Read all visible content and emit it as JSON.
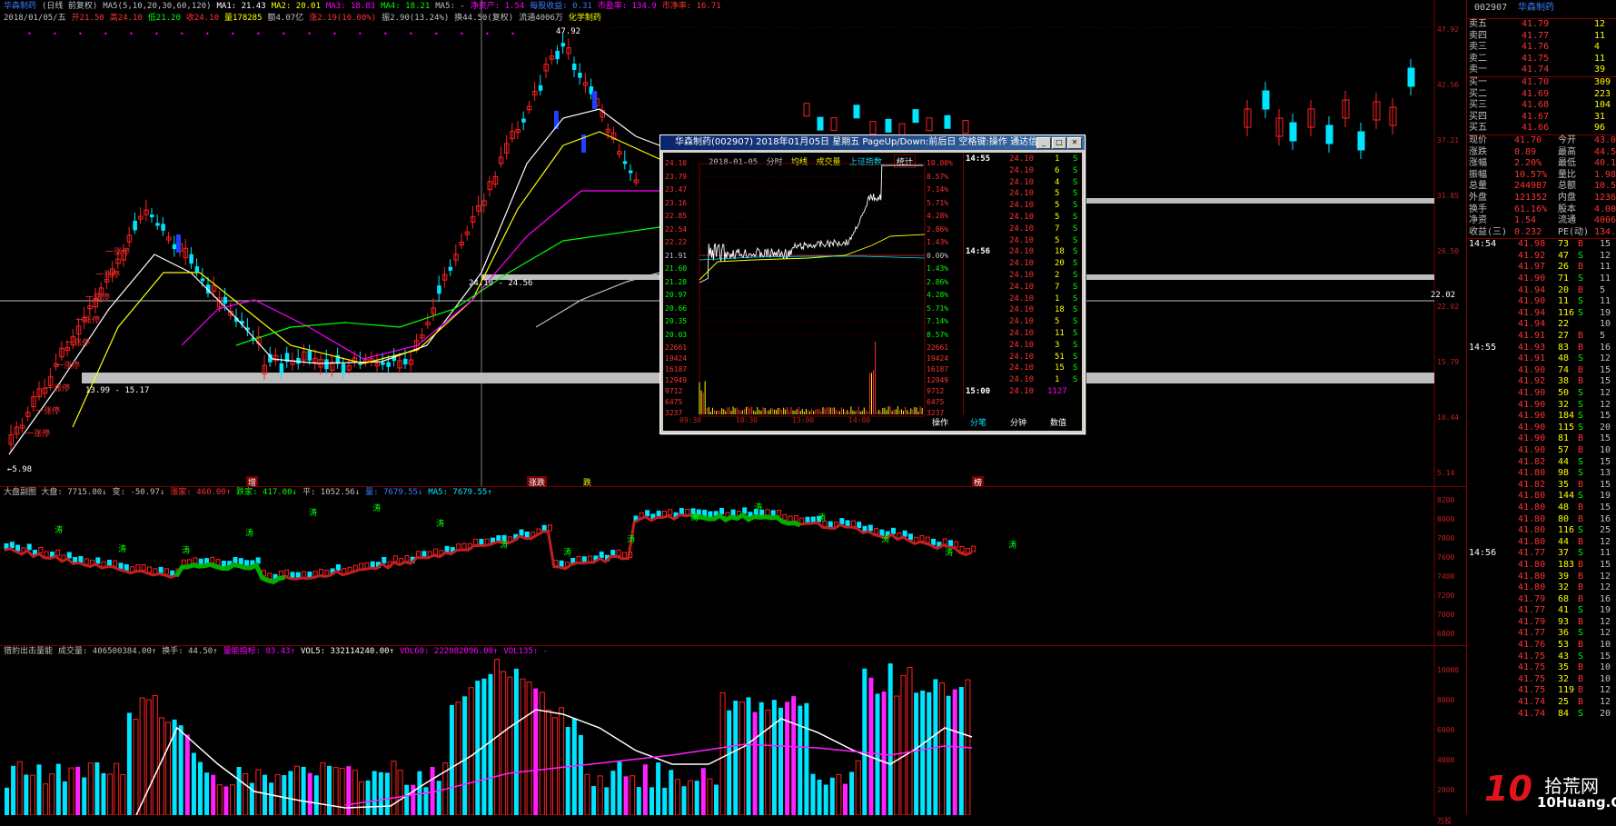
{
  "main_header": {
    "line1": [
      {
        "t": "华森制药",
        "c": "#3c7cff"
      },
      {
        "t": "(日线 前复权)",
        "c": "#c0c0c0"
      },
      {
        "t": "MA5(5,10,20,30,60,120)",
        "c": "#c0c0c0"
      },
      {
        "t": "MA1: 21.43",
        "c": "#ffffff"
      },
      {
        "t": "MA2: 20.01",
        "c": "#ffff00"
      },
      {
        "t": "MA3: 18.83",
        "c": "#ff00ff"
      },
      {
        "t": "MA4: 18.21",
        "c": "#00ff00"
      },
      {
        "t": "MA5: -",
        "c": "#c0c0c0"
      },
      {
        "t": "净资产: 1.54",
        "c": "#ff00ff"
      },
      {
        "t": "每股收益: 0.31",
        "c": "#3c7cff"
      },
      {
        "t": "市盈率: 134.9",
        "c": "#ff00ff"
      },
      {
        "t": "市净率: 16.71",
        "c": "#ff3232"
      }
    ],
    "line2": [
      {
        "t": "2018/01/05/五",
        "c": "#c0c0c0"
      },
      {
        "t": "开21.50",
        "c": "#ff3232"
      },
      {
        "t": "高24.10",
        "c": "#ff3232"
      },
      {
        "t": "低21.20",
        "c": "#00ff00"
      },
      {
        "t": "收24.10",
        "c": "#ff3232"
      },
      {
        "t": "量178285",
        "c": "#ffff00"
      },
      {
        "t": "额4.07亿",
        "c": "#c0c0c0"
      },
      {
        "t": "涨2.19(10.00%)",
        "c": "#ff3232"
      },
      {
        "t": "振2.90(13.24%)",
        "c": "#c0c0c0"
      },
      {
        "t": "换44.50(复权)",
        "c": "#c0c0c0"
      },
      {
        "t": "流通4006万",
        "c": "#c0c0c0"
      },
      {
        "t": "化学制药",
        "c": "#ffff00"
      }
    ]
  },
  "main_chart": {
    "high_label": "47.92",
    "range1": "13.99 - 15.17",
    "range2": "24.10 - 24.56",
    "low_label": "5.98",
    "price_ticks": [
      "47.92",
      "42.56",
      "37.21",
      "31.85",
      "26.50",
      "22.02",
      "15.79",
      "10.44",
      "5.14"
    ],
    "crosshair_value": "22.02",
    "markers": [
      "增",
      "涨跌",
      "跌",
      "榜"
    ],
    "signal": "一涨停"
  },
  "index_panel": {
    "header": [
      {
        "t": "大盘副图 大盘: 7715.80↓",
        "c": "#c0c0c0"
      },
      {
        "t": "变: -50.97↓",
        "c": "#c0c0c0"
      },
      {
        "t": "涨家: 460.00↑",
        "c": "#ff3232"
      },
      {
        "t": "跌家: 417.00↓",
        "c": "#00ff00"
      },
      {
        "t": "平: 1052.56↓",
        "c": "#c0c0c0"
      },
      {
        "t": "量: 7679.55↓",
        "c": "#3c7cff"
      },
      {
        "t": "MA5: 7679.55↑",
        "c": "#00e5ff"
      }
    ],
    "ticks": [
      "8200",
      "8000",
      "7800",
      "7600",
      "7400",
      "7200",
      "7000",
      "6800"
    ],
    "tag": "涛"
  },
  "volume_panel": {
    "header": [
      {
        "t": "猎豹出击量能",
        "c": "#c0c0c0"
      },
      {
        "t": "成交量: 406500384.00↑",
        "c": "#c0c0c0"
      },
      {
        "t": "换手: 44.50↑",
        "c": "#c0c0c0"
      },
      {
        "t": "量能指标: 83.43↑",
        "c": "#ff00ff"
      },
      {
        "t": "VOL5: 332114240.00↑",
        "c": "#ffffff"
      },
      {
        "t": "VOL60: 222082096.00↑",
        "c": "#ff00ff"
      },
      {
        "t": "VOL135: -",
        "c": "#ff00ff"
      }
    ],
    "ticks": [
      "10000",
      "8000",
      "6000",
      "4000",
      "2000",
      "万股"
    ]
  },
  "popup": {
    "title": "华森制药(002907) 2018年01月05日 星期五 PageUp/Down:前后日 空格键:操作 通达信(R)",
    "sub_date": "2018-01-05",
    "sub_items": [
      "分时",
      "均线",
      "成交量",
      "上证指数"
    ],
    "stat_btn": "统计",
    "left_prices": [
      "24.10",
      "23.79",
      "23.47",
      "23.16",
      "22.85",
      "22.54",
      "22.22",
      "21.91",
      "21.60",
      "21.28",
      "20.97",
      "20.66",
      "20.35",
      "20.03"
    ],
    "right_pcts": [
      "10.00%",
      "8.57%",
      "7.14%",
      "5.71%",
      "4.28%",
      "2.86%",
      "1.43%",
      "0.00%",
      "1.43%",
      "2.86%",
      "4.28%",
      "5.71%",
      "7.14%",
      "8.57%"
    ],
    "vol_ticks": [
      "22661",
      "19424",
      "16187",
      "12949",
      "9712",
      "6475",
      "3237"
    ],
    "times": [
      "09:30",
      "10:30",
      "13:00",
      "14:00"
    ],
    "op_btn": "操作",
    "ticks_groups": [
      {
        "time": "14:55",
        "rows": [
          [
            "24.10",
            "1",
            "S"
          ],
          [
            "24.10",
            "6",
            "S"
          ],
          [
            "24.10",
            "4",
            "S"
          ],
          [
            "24.10",
            "5",
            "S"
          ],
          [
            "24.10",
            "5",
            "S"
          ],
          [
            "24.10",
            "5",
            "S"
          ],
          [
            "24.10",
            "7",
            "S"
          ],
          [
            "24.10",
            "5",
            "S"
          ]
        ]
      },
      {
        "time": "14:56",
        "rows": [
          [
            "24.10",
            "18",
            "S"
          ],
          [
            "24.10",
            "20",
            "S"
          ],
          [
            "24.10",
            "2",
            "S"
          ],
          [
            "24.10",
            "7",
            "S"
          ],
          [
            "24.10",
            "1",
            "S"
          ],
          [
            "24.10",
            "18",
            "S"
          ],
          [
            "24.10",
            "5",
            "S"
          ],
          [
            "24.10",
            "11",
            "S"
          ],
          [
            "24.10",
            "3",
            "S"
          ],
          [
            "24.10",
            "51",
            "S"
          ],
          [
            "24.10",
            "15",
            "S"
          ],
          [
            "24.10",
            "1",
            "S"
          ]
        ]
      },
      {
        "time": "15:00",
        "rows": [
          [
            "24.10",
            "1127",
            ""
          ]
        ]
      }
    ],
    "tabs": [
      "分笔",
      "分钟",
      "数值"
    ]
  },
  "quote": {
    "code": "002907",
    "name": "华森制药",
    "sell": [
      [
        "卖五",
        "41.79",
        "12"
      ],
      [
        "卖四",
        "41.77",
        "11"
      ],
      [
        "卖三",
        "41.76",
        "4"
      ],
      [
        "卖二",
        "41.75",
        "11"
      ],
      [
        "卖一",
        "41.74",
        "39"
      ]
    ],
    "buy": [
      [
        "买一",
        "41.70",
        "309"
      ],
      [
        "买二",
        "41.69",
        "223"
      ],
      [
        "买三",
        "41.68",
        "104"
      ],
      [
        "买四",
        "41.67",
        "31"
      ],
      [
        "买五",
        "41.66",
        "96"
      ]
    ],
    "stats": [
      [
        "现价",
        "41.70",
        "今开",
        "43.00"
      ],
      [
        "涨跌",
        "0.89",
        "最高",
        "44.50"
      ],
      [
        "涨幅",
        "2.20%",
        "最低",
        "40.10"
      ],
      [
        "振幅",
        "10.57%",
        "量比",
        "1.98"
      ],
      [
        "总量",
        "244987",
        "总额",
        "10.5亿"
      ],
      [
        "外盘",
        "121352",
        "内盘",
        "123635"
      ],
      [
        "换手",
        "61.16%",
        "股本",
        "4.00亿"
      ],
      [
        "净资",
        "1.54",
        "流通",
        "4006万"
      ],
      [
        "收益(三)",
        "0.232",
        "PE(动)",
        "134.9"
      ]
    ],
    "ticks": [
      [
        "14:54",
        "41.98",
        "73",
        "B",
        "15"
      ],
      [
        "",
        "41.92",
        "47",
        "S",
        "12"
      ],
      [
        "",
        "41.97",
        "26",
        "B",
        "11"
      ],
      [
        "",
        "41.90",
        "71",
        "S",
        "11"
      ],
      [
        "",
        "41.94",
        "20",
        "B",
        "5"
      ],
      [
        "",
        "41.90",
        "11",
        "S",
        "11"
      ],
      [
        "",
        "41.94",
        "116",
        "S",
        "19"
      ],
      [
        "",
        "41.94",
        "22",
        "",
        "10"
      ],
      [
        "",
        "41.91",
        "27",
        "B",
        "5"
      ],
      [
        "14:55",
        "41.93",
        "83",
        "B",
        "16"
      ],
      [
        "",
        "41.91",
        "48",
        "S",
        "12"
      ],
      [
        "",
        "41.90",
        "74",
        "B",
        "15"
      ],
      [
        "",
        "41.92",
        "38",
        "B",
        "15"
      ],
      [
        "",
        "41.90",
        "50",
        "S",
        "12"
      ],
      [
        "",
        "41.90",
        "32",
        "S",
        "12"
      ],
      [
        "",
        "41.90",
        "184",
        "S",
        "15"
      ],
      [
        "",
        "41.90",
        "115",
        "S",
        "20"
      ],
      [
        "",
        "41.90",
        "81",
        "B",
        "15"
      ],
      [
        "",
        "41.90",
        "57",
        "B",
        "10"
      ],
      [
        "",
        "41.82",
        "44",
        "S",
        "15"
      ],
      [
        "",
        "41.80",
        "98",
        "S",
        "13"
      ],
      [
        "",
        "41.82",
        "35",
        "B",
        "15"
      ],
      [
        "",
        "41.80",
        "144",
        "S",
        "19"
      ],
      [
        "",
        "41.80",
        "48",
        "B",
        "15"
      ],
      [
        "",
        "41.80",
        "80",
        "B",
        "16"
      ],
      [
        "",
        "41.80",
        "116",
        "S",
        "25"
      ],
      [
        "",
        "41.80",
        "44",
        "B",
        "12"
      ],
      [
        "14:56",
        "41.77",
        "37",
        "S",
        "11"
      ],
      [
        "",
        "41.80",
        "183",
        "B",
        "15"
      ],
      [
        "",
        "41.80",
        "39",
        "B",
        "12"
      ],
      [
        "",
        "41.80",
        "32",
        "B",
        "12"
      ],
      [
        "",
        "41.79",
        "68",
        "B",
        "16"
      ],
      [
        "",
        "41.77",
        "41",
        "S",
        "19"
      ],
      [
        "",
        "41.79",
        "93",
        "B",
        "12"
      ],
      [
        "",
        "41.77",
        "36",
        "S",
        "12"
      ],
      [
        "",
        "41.76",
        "53",
        "B",
        "10"
      ],
      [
        "",
        "41.75",
        "43",
        "S",
        "15"
      ],
      [
        "",
        "41.75",
        "35",
        "B",
        "10"
      ],
      [
        "",
        "41.75",
        "32",
        "B",
        "10"
      ],
      [
        "",
        "41.75",
        "119",
        "B",
        "12"
      ],
      [
        "",
        "41.74",
        "25",
        "B",
        "12"
      ],
      [
        "",
        "41.74",
        "84",
        "S",
        "20"
      ]
    ]
  },
  "watermark": {
    "num": "10",
    "brand": "拾荒网",
    "domain": "10Huang.CN"
  }
}
